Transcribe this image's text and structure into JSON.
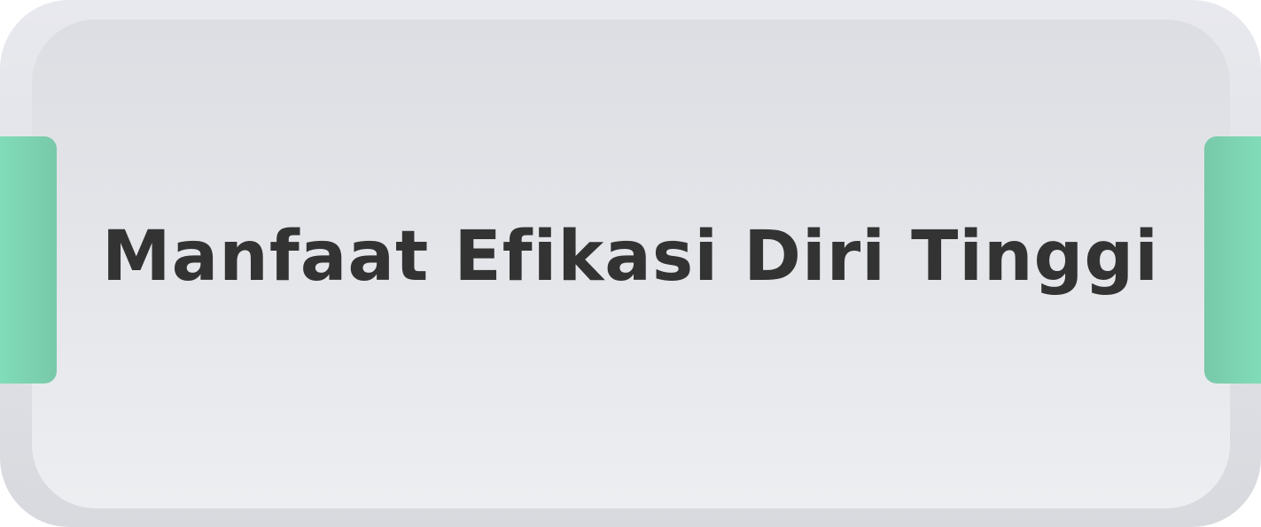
{
  "card": {
    "title": "Manfaat Efikasi Diri Tinggi"
  },
  "colors": {
    "outer_frame": "#e4e6ea",
    "inner_panel": "#e3e5e9",
    "accent_tab": "#7fd6b5",
    "title_text": "#333333"
  }
}
